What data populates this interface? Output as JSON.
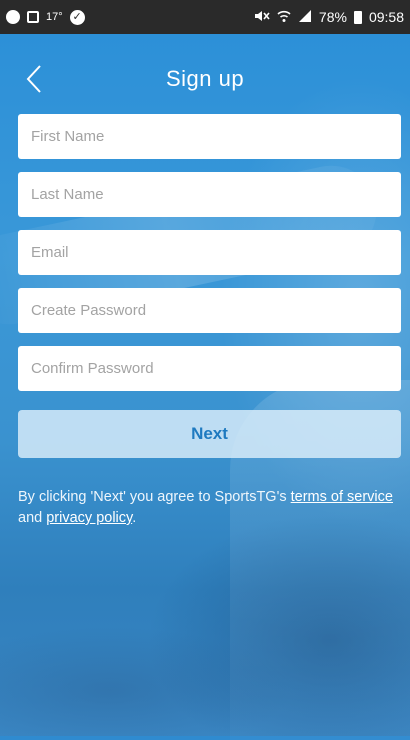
{
  "status_bar": {
    "temperature": "17°",
    "battery": "78%",
    "time": "09:58"
  },
  "header": {
    "title": "Sign up"
  },
  "form": {
    "first_name_placeholder": "First Name",
    "last_name_placeholder": "Last Name",
    "email_placeholder": "Email",
    "password_placeholder": "Create Password",
    "confirm_password_placeholder": "Confirm Password"
  },
  "next_button": "Next",
  "legal": {
    "prefix": "By clicking 'Next' you agree to SportsTG's ",
    "terms_link": "terms of service",
    "middle": " and ",
    "privacy_link": "privacy policy",
    "suffix": "."
  },
  "colors": {
    "background": "#2f8bd0",
    "status_bar": "#2a2a2a",
    "button_text": "#1f7ac0"
  }
}
